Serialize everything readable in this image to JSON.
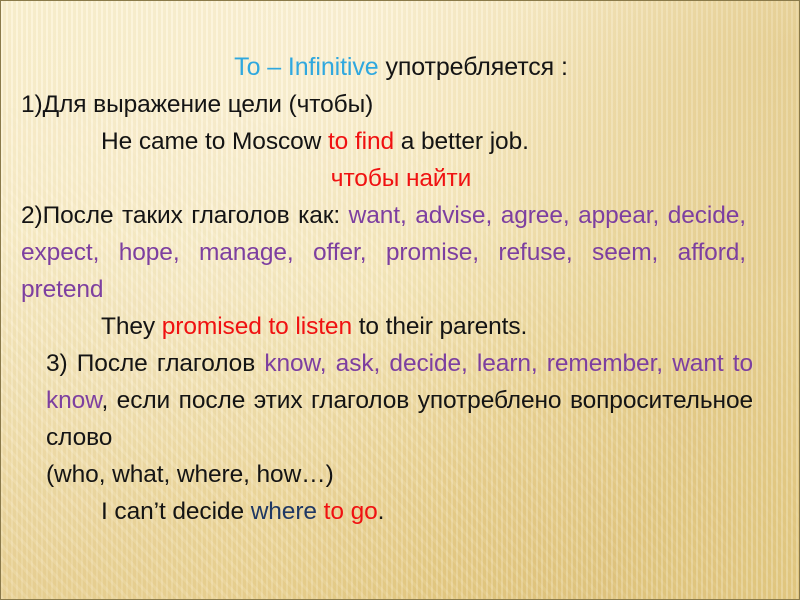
{
  "slide": {
    "background_color": "#f3e6b5",
    "border_color": "#8a7a4a",
    "accent_colors": {
      "title_blue": "#2FA8DF",
      "highlight_red": "#F01111",
      "verb_purple": "#7D3FA0",
      "question_word_navy": "#1F3864",
      "body_black": "#141414"
    }
  },
  "title": {
    "english": "To – Infinitive",
    "russian": " употребляется :"
  },
  "rule1": {
    "number": "1)",
    "text": "Для выражение цели (чтобы)",
    "example": {
      "before": "He came to Moscow ",
      "highlight": "to find",
      "after": " a better job."
    },
    "translation": "чтобы найти"
  },
  "rule2": {
    "number": "2)",
    "lead": "После таких глаголов как: ",
    "verbs": "want, advise, agree, appear, decide, expect, hope, manage, offer, promise, refuse, seem, afford, pretend",
    "example": {
      "before": "They ",
      "highlight": "promised to listen",
      "after": " to their parents."
    }
  },
  "rule3": {
    "number": "3) ",
    "lead": "После глаголов ",
    "verbs": "know, ask, decide, learn, remember, want to know",
    "condition": ", если после этих глаголов употреблено вопросительное слово",
    "question_words": "(who, what, where, how…)",
    "example": {
      "before": "I can’t decide ",
      "question_word": "where",
      "space": " ",
      "highlight": "to go",
      "after": "."
    }
  }
}
